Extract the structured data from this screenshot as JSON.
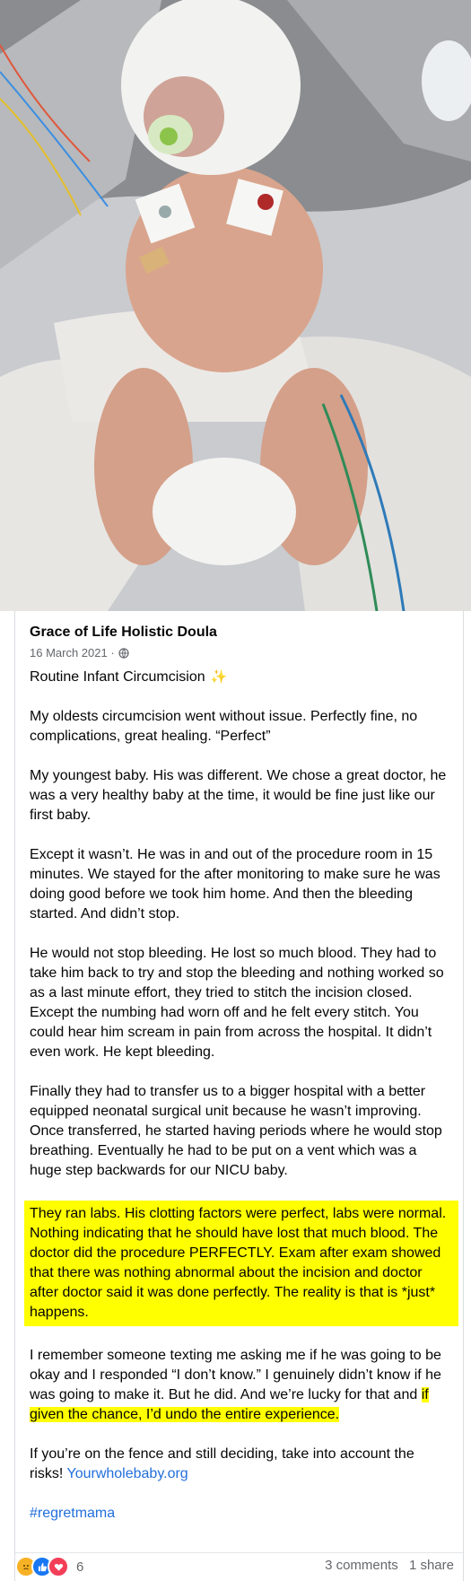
{
  "post": {
    "author": "Grace of Life Holistic Doula",
    "date": "16 March 2021 ·",
    "privacy_icon": "globe-icon",
    "title": "Routine Infant Circumcision",
    "title_emoji": "✨",
    "paragraphs": [
      "My oldests circumcision went without issue. Perfectly fine, no complications, great healing. “Perfect”",
      "My youngest baby. His was different. We chose a great doctor, he was a very healthy baby at the time, it would be fine just like our first baby.",
      "Except it wasn’t. He was in and out of the procedure room in 15 minutes. We stayed for the after monitoring to make sure he was doing good before we took him home. And then the bleeding started. And didn’t stop.",
      "He would not stop bleeding. He lost so much blood. They had to take him back to try and stop the bleeding and nothing worked so as a last minute effort, they tried to stitch the incision closed. Except the numbing had worn off and he felt every stitch. You could hear him scream in pain from across the hospital. It didn’t even work. He kept bleeding.",
      "Finally they had to transfer us to a bigger hospital with a better equipped neonatal surgical unit because he wasn’t improving. Once transferred, he started having periods where he would stop breathing. Eventually he had to be put on a vent which was a huge step backwards for our NICU baby."
    ],
    "highlighted_paragraph": "They ran labs. His clotting factors were perfect, labs were normal. Nothing indicating that he should have lost that much blood. The doctor did the procedure PERFECTLY. Exam after exam showed that there was nothing abnormal about the incision and doctor after doctor said it was done perfectly. The reality is that is *just* happens.",
    "remember_text": "I remember someone texting me asking me if he was going to be okay and I responded “I don’t know.” I genuinely didn’t know if he was going to make it. But he did. And we’re lucky for that and",
    "remember_highlight": "if given the chance, I’d undo the entire experience.",
    "closing_text": "If you’re on the fence and still deciding, take into account the risks!",
    "closing_link": "Yourwholebaby.org",
    "hashtag": "#regretmama"
  },
  "footer": {
    "reaction_count": "6",
    "comments": "3 comments",
    "shares": "1 share"
  }
}
